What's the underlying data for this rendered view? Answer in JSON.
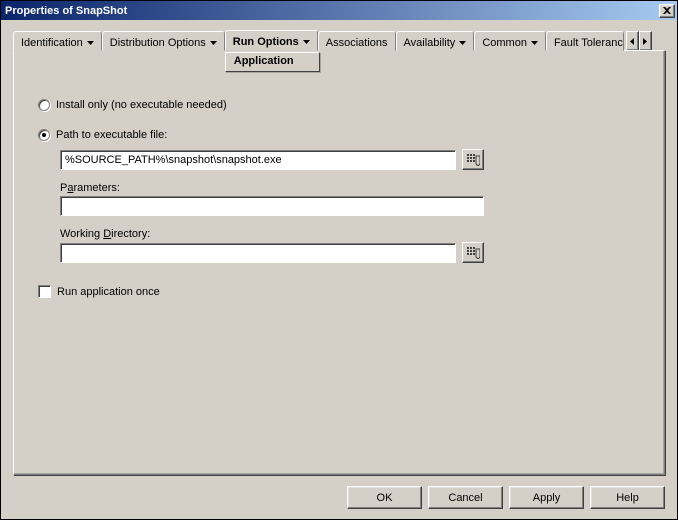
{
  "window": {
    "title": "Properties of SnapShot"
  },
  "tabs": {
    "identification": "Identification",
    "distribution": "Distribution Options",
    "run": "Run Options",
    "associations": "Associations",
    "availability": "Availability",
    "common": "Common",
    "fault": "Fault Toleranc",
    "dropdown_item": "Application"
  },
  "form": {
    "install_only_label": "Install only (no executable needed)",
    "path_to_exe_label": "Path to executable file:",
    "path_value": "%SOURCE_PATH%\\snapshot\\snapshot.exe",
    "parameters_label_pre": "P",
    "parameters_label_ul": "a",
    "parameters_label_post": "rameters:",
    "parameters_value": "",
    "workdir_label_pre": "Working ",
    "workdir_label_ul": "D",
    "workdir_label_post": "irectory:",
    "workdir_value": "",
    "run_once_pre": "",
    "run_once_ul": "R",
    "run_once_post": "un application once"
  },
  "buttons": {
    "ok": "OK",
    "cancel": "Cancel",
    "apply": "Apply",
    "help": "Help"
  }
}
